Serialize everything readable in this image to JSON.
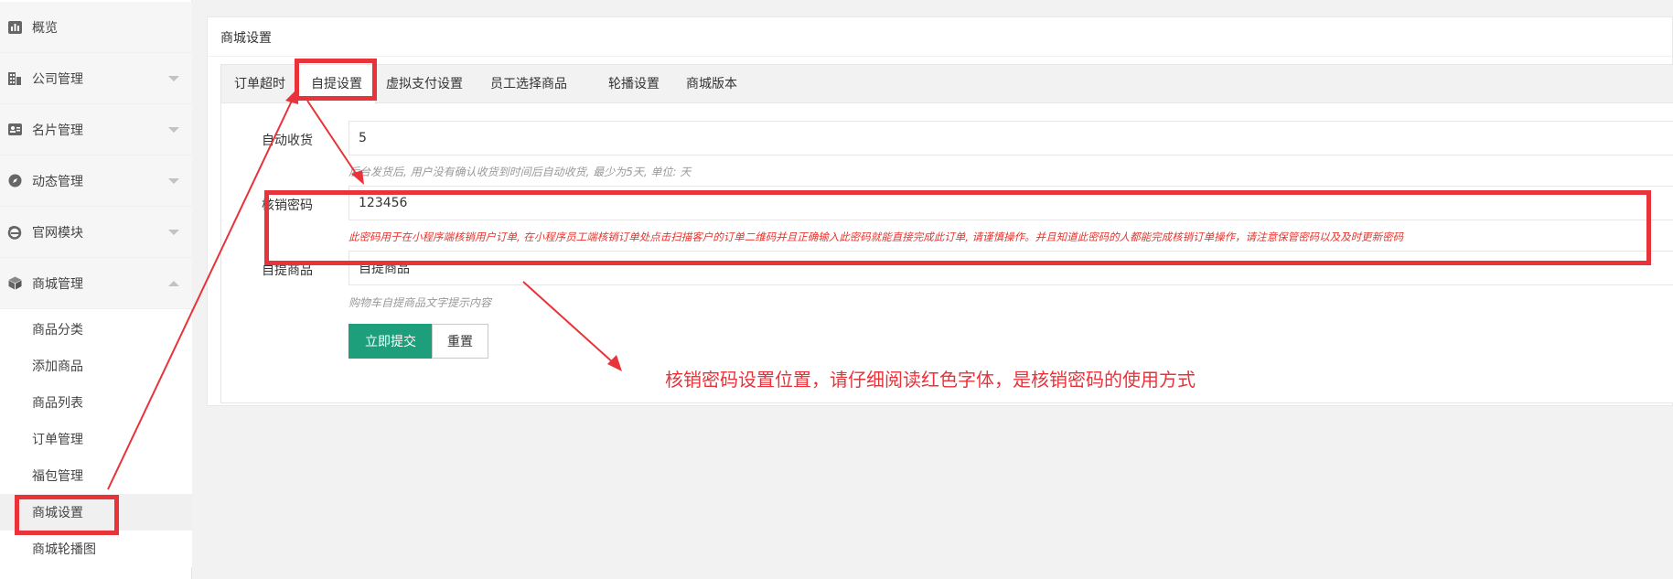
{
  "sidebar": {
    "items": [
      {
        "label": "概览",
        "icon": "chart-icon"
      },
      {
        "label": "公司管理",
        "icon": "building-icon"
      },
      {
        "label": "名片管理",
        "icon": "card-icon"
      },
      {
        "label": "动态管理",
        "icon": "compass-icon"
      },
      {
        "label": "官网模块",
        "icon": "browser-icon"
      },
      {
        "label": "商城管理",
        "icon": "box-icon"
      }
    ],
    "sub_items": [
      {
        "label": "商品分类"
      },
      {
        "label": "添加商品"
      },
      {
        "label": "商品列表"
      },
      {
        "label": "订单管理"
      },
      {
        "label": "福包管理"
      },
      {
        "label": "商城设置"
      },
      {
        "label": "商城轮播图"
      }
    ]
  },
  "panel": {
    "title": "商城设置",
    "tabs": [
      {
        "label": "订单超时"
      },
      {
        "label": "自提设置"
      },
      {
        "label": "虚拟支付设置"
      },
      {
        "label": "员工选择商品"
      },
      {
        "label": "轮播设置"
      },
      {
        "label": "商城版本"
      }
    ]
  },
  "form": {
    "auto_receive": {
      "label": "自动收货",
      "value": "5",
      "hint": "后台发货后, 用户没有确认收货到时间后自动收货, 最少为5天, 单位: 天"
    },
    "verify_password": {
      "label": "核销密码",
      "value": "123456",
      "hint": "此密码用于在小程序端核销用户订单, 在小程序员工端核销订单处点击扫描客户的订单二维码并且正确输入此密码就能直接完成此订单, 请谨慎操作。并且知道此密码的人都能完成核销订单操作，请注意保管密码以及及时更新密码"
    },
    "pickup_goods": {
      "label": "自提商品",
      "value": "自提商品",
      "hint": "购物车自提商品文字提示内容"
    },
    "submit_label": "立即提交",
    "reset_label": "重置"
  },
  "annotation": {
    "text": "核销密码设置位置，请仔细阅读红色字体，是核销密码的使用方式"
  },
  "colors": {
    "primary": "#1e9f7c",
    "highlight": "#e8333a",
    "hint_red": "#e8332b"
  }
}
